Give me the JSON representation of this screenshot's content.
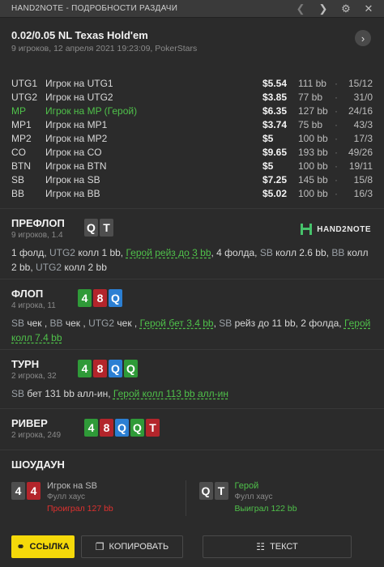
{
  "window": {
    "title": "HAND2NOTE - ПОДРОБНОСТИ РАЗДАЧИ",
    "icons": [
      "chevron-left-icon",
      "chevron-right-icon",
      "gear-icon",
      "close-icon"
    ]
  },
  "header": {
    "game": "0.02/0.05 NL Texas Hold'em",
    "subtitle": "9 игроков, 12 апреля 2021 19:23:09, PokerStars"
  },
  "players": [
    {
      "pos": "UTG1",
      "name": "Игрок на UTG1",
      "amount": "$5.54",
      "bb": "111 bb",
      "stats": "15/12",
      "hero": false
    },
    {
      "pos": "UTG2",
      "name": "Игрок на UTG2",
      "amount": "$3.85",
      "bb": "77 bb",
      "stats": "31/0",
      "hero": false
    },
    {
      "pos": "MP",
      "name": "Игрок на MP (Герой)",
      "amount": "$6.35",
      "bb": "127 bb",
      "stats": "24/16",
      "hero": true
    },
    {
      "pos": "MP1",
      "name": "Игрок на MP1",
      "amount": "$3.74",
      "bb": "75 bb",
      "stats": "43/3",
      "hero": false
    },
    {
      "pos": "MP2",
      "name": "Игрок на MP2",
      "amount": "$5",
      "bb": "100 bb",
      "stats": "17/3",
      "hero": false
    },
    {
      "pos": "CO",
      "name": "Игрок на CO",
      "amount": "$9.65",
      "bb": "193 bb",
      "stats": "49/26",
      "hero": false
    },
    {
      "pos": "BTN",
      "name": "Игрок на BTN",
      "amount": "$5",
      "bb": "100 bb",
      "stats": "19/11",
      "hero": false
    },
    {
      "pos": "SB",
      "name": "Игрок на SB",
      "amount": "$7.25",
      "bb": "145 bb",
      "stats": "15/8",
      "hero": false
    },
    {
      "pos": "BB",
      "name": "Игрок на BB",
      "amount": "$5.02",
      "bb": "100 bb",
      "stats": "16/3",
      "hero": false
    }
  ],
  "preflop": {
    "name": "ПРЕФЛОП",
    "info": "9 игроков, 1.4",
    "cards": [
      {
        "r": "Q",
        "c": "grey"
      },
      {
        "r": "T",
        "c": "grey"
      }
    ],
    "logo": "HAND2NOTE",
    "actions": [
      {
        "t": "1 фолд, ",
        "k": "n"
      },
      {
        "t": "UTG2",
        "k": "p"
      },
      {
        "t": " колл 1 bb, ",
        "k": "n"
      },
      {
        "t": "Герой рейз до 3 bb",
        "k": "h"
      },
      {
        "t": ", 4 фолда, ",
        "k": "n"
      },
      {
        "t": "SB",
        "k": "p"
      },
      {
        "t": " колл 2.6 bb, ",
        "k": "n"
      },
      {
        "t": "BB",
        "k": "p"
      },
      {
        "t": " колл 2 bb, ",
        "k": "n"
      },
      {
        "t": "UTG2",
        "k": "p"
      },
      {
        "t": " колл 2 bb",
        "k": "n"
      }
    ]
  },
  "flop": {
    "name": "ФЛОП",
    "info": "4 игрока, 11",
    "cards": [
      {
        "r": "4",
        "c": "green"
      },
      {
        "r": "8",
        "c": "red"
      },
      {
        "r": "Q",
        "c": "blue"
      }
    ],
    "actions": [
      {
        "t": "SB",
        "k": "p"
      },
      {
        "t": " чек , ",
        "k": "n"
      },
      {
        "t": "BB",
        "k": "p"
      },
      {
        "t": " чек , ",
        "k": "n"
      },
      {
        "t": "UTG2",
        "k": "p"
      },
      {
        "t": " чек , ",
        "k": "n"
      },
      {
        "t": "Герой бет 3.4 bb",
        "k": "h"
      },
      {
        "t": ", ",
        "k": "n"
      },
      {
        "t": "SB",
        "k": "p"
      },
      {
        "t": " рейз до 11 bb, 2 фолда, ",
        "k": "n"
      },
      {
        "t": "Герой колл 7.4 bb",
        "k": "h"
      }
    ]
  },
  "turn": {
    "name": "ТУРН",
    "info": "2 игрока, 32",
    "cards": [
      {
        "r": "4",
        "c": "green"
      },
      {
        "r": "8",
        "c": "red"
      },
      {
        "r": "Q",
        "c": "blue"
      },
      {
        "r": "Q",
        "c": "green"
      }
    ],
    "actions": [
      {
        "t": "SB",
        "k": "p"
      },
      {
        "t": " бет 131 bb алл-ин, ",
        "k": "n"
      },
      {
        "t": "Герой колл 113 bb алл-ин",
        "k": "h"
      }
    ]
  },
  "river": {
    "name": "РИВЕР",
    "info": "2 игрока, 249",
    "cards": [
      {
        "r": "4",
        "c": "green"
      },
      {
        "r": "8",
        "c": "red"
      },
      {
        "r": "Q",
        "c": "blue"
      },
      {
        "r": "Q",
        "c": "green"
      },
      {
        "r": "T",
        "c": "red"
      }
    ]
  },
  "showdown": {
    "name": "ШОУДАУН",
    "left": {
      "cards": [
        {
          "r": "4",
          "c": "grey"
        },
        {
          "r": "4",
          "c": "red"
        }
      ],
      "player": "Игрок на SB",
      "hand": "Фулл хаус",
      "result": "Проиграл 127 bb"
    },
    "right": {
      "cards": [
        {
          "r": "Q",
          "c": "grey"
        },
        {
          "r": "T",
          "c": "grey"
        }
      ],
      "player": "Герой",
      "hand": "Фулл хаус",
      "result": "Выиграл 122 bb"
    }
  },
  "footer": {
    "link": "ССЫЛКА",
    "copy": "КОПИРОВАТЬ",
    "text": "ТЕКСТ"
  },
  "colors": {
    "hero": "#4fc14a",
    "link_button": "#f5d90a",
    "loss": "#e0312f",
    "card_red": "#b3252b",
    "card_green": "#2f9a38",
    "card_blue": "#2b7fd3",
    "card_grey": "#4e4e4e"
  }
}
